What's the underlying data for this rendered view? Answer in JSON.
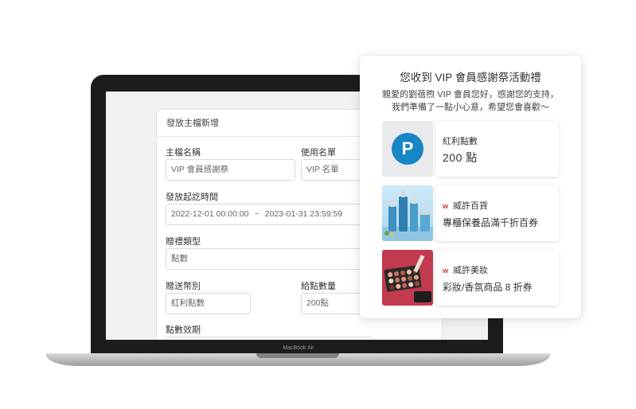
{
  "laptop": {
    "brand": "MacBook Air"
  },
  "form": {
    "header": "發放主檔新增",
    "fields": {
      "name": {
        "label": "主檔名稱",
        "placeholder": "VIP 會員感謝祭"
      },
      "list": {
        "label": "使用名單",
        "placeholder": "VIP 名單"
      },
      "period": {
        "label": "發放起訖時間",
        "start": "2022-12-01 00:00:00",
        "separator": "~",
        "end": "2023-01-31 23:59:59"
      },
      "gift_type": {
        "label": "贈禮類型",
        "value": "點數"
      },
      "currency": {
        "label": "贈送幣別",
        "value": "紅利點數"
      },
      "amount": {
        "label": "給點數量",
        "value": "200點"
      },
      "validity": {
        "label": "點數效期"
      }
    }
  },
  "popup": {
    "title": "您收到 VIP 會員感謝祭活動禮",
    "message_line1": "親愛的劉蓓煦 VIP 會員您好，感謝您的支持，",
    "message_line2": "我們準備了一點小心意，希望您會喜歡～",
    "rewards": [
      {
        "label": "紅利點數",
        "value": "200 點",
        "icon": "P"
      },
      {
        "brand_mark": "w",
        "label": "威許百貨",
        "value": "專櫃保養品滿千折百券"
      },
      {
        "brand_mark": "w",
        "label": "威許美妝",
        "value": "彩妝/香氛商品 8 折券"
      }
    ]
  },
  "colors": {
    "point_badge": "#1686c4",
    "brand_red": "#c4382c",
    "laptop_body": "#1c1c1e"
  }
}
